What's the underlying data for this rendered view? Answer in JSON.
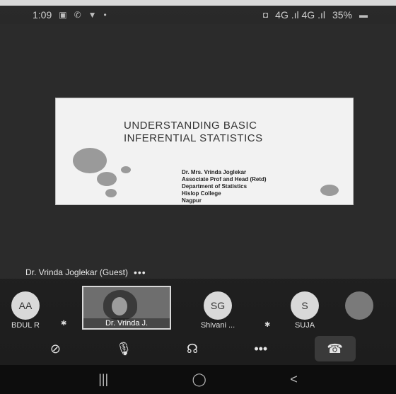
{
  "status_bar": {
    "time": "1:09",
    "signal_text": "4G .ıl  4G .ıl",
    "battery": "35%"
  },
  "slide": {
    "title_line1": "UNDERSTANDING BASIC",
    "title_line2": "INFERENTIAL STATISTICS",
    "author_line1": "Dr. Mrs. Vrinda Joglekar",
    "author_line2": "Associate Prof and Head (Retd)",
    "author_line3": "Department of Statistics",
    "author_line4": "Hislop College",
    "author_line5": "Nagpur"
  },
  "presenter": {
    "name": "Dr. Vrinda Joglekar (Guest)",
    "more": "•••"
  },
  "participants": [
    {
      "initials": "AA",
      "name": "BDUL R"
    },
    {
      "initials": "",
      "name": "Dr. Vrinda J."
    },
    {
      "initials": "SG",
      "name": "Shivani ..."
    },
    {
      "initials": "S",
      "name": "SUJA"
    }
  ],
  "controls": {
    "more": "•••"
  },
  "navbar": {
    "recent": "|||",
    "home": "◯",
    "back": "<"
  },
  "colors": {
    "background": "#2b2b2b",
    "slide_bg": "#f2f2f2",
    "avatar_bg": "#d9d9d9"
  }
}
